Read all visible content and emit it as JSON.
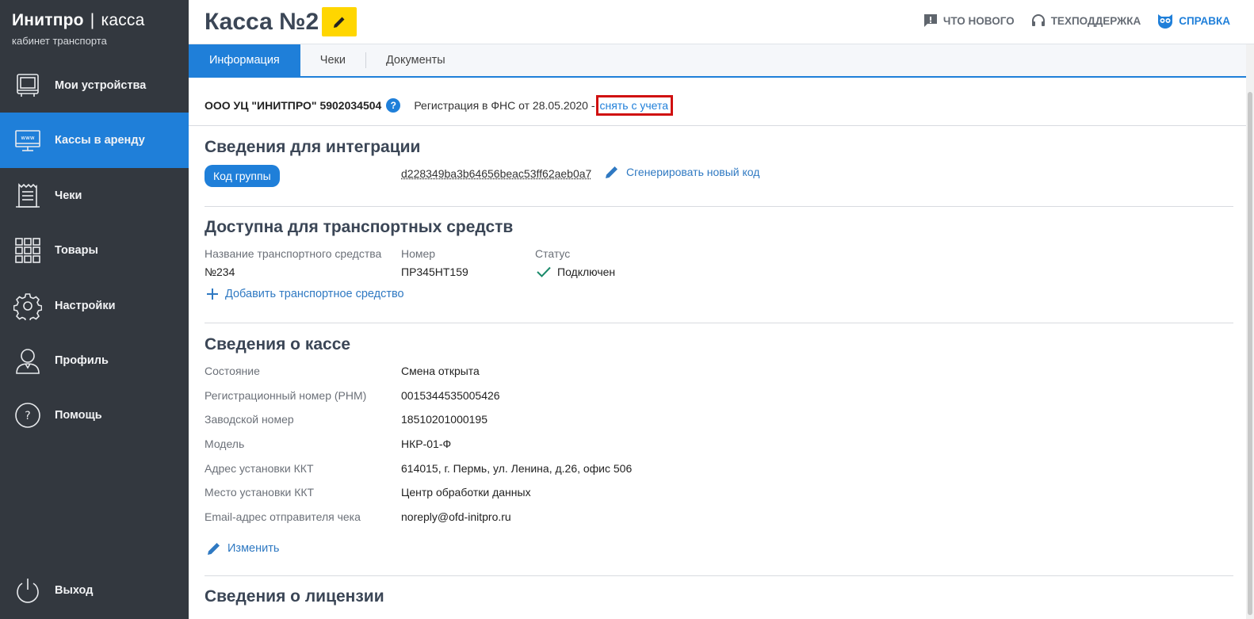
{
  "brand": {
    "title_bold": "Инитпро",
    "separator": "|",
    "title_light": "касса",
    "subtitle": "кабинет транспорта"
  },
  "sidebar": {
    "items": [
      {
        "label": "Мои устройства",
        "icon": "devices-icon"
      },
      {
        "label": "Кассы в аренду",
        "icon": "www-monitor-icon",
        "active": true
      },
      {
        "label": "Чеки",
        "icon": "receipt-icon"
      },
      {
        "label": "Товары",
        "icon": "grid-icon"
      },
      {
        "label": "Настройки",
        "icon": "gear-icon"
      },
      {
        "label": "Профиль",
        "icon": "user-icon"
      },
      {
        "label": "Помощь",
        "icon": "help-circle-icon"
      }
    ],
    "logout": {
      "label": "Выход",
      "icon": "power-icon"
    }
  },
  "header": {
    "title": "Касса №2",
    "links": {
      "whats_new": "ЧТО НОВОГО",
      "support": "ТЕХПОДДЕРЖКА",
      "help": "СПРАВКА"
    }
  },
  "tabs": [
    {
      "label": "Информация",
      "active": true
    },
    {
      "label": "Чеки"
    },
    {
      "label": "Документы"
    }
  ],
  "org": {
    "name": "ООО УЦ \"ИНИТПРО\" 5902034504",
    "help_glyph": "?",
    "registration": "Регистрация в ФНС от 28.05.2020 -",
    "unregister_link": "снять с учета"
  },
  "integration": {
    "title": "Сведения для интеграции",
    "group_code_button": "Код группы",
    "code": "d228349ba3b64656beac53ff62aeb0a7",
    "generate_link": "Сгенерировать новый код"
  },
  "vehicles": {
    "title": "Доступна для транспортных средств",
    "columns": [
      "Название транспортного средства",
      "Номер",
      "Статус"
    ],
    "rows": [
      {
        "name": "№234",
        "number": "ПР345НТ159",
        "status": "Подключен"
      }
    ],
    "add_link": "Добавить транспортное средство"
  },
  "kkt": {
    "title": "Сведения о кассе",
    "fields": [
      {
        "label": "Состояние",
        "value": "Смена открыта"
      },
      {
        "label": "Регистрационный номер (РНМ)",
        "value": "0015344535005426"
      },
      {
        "label": "Заводской номер",
        "value": "18510201000195"
      },
      {
        "label": "Модель",
        "value": "НКР-01-Ф"
      },
      {
        "label": "Адрес установки ККТ",
        "value": "614015, г. Пермь, ул. Ленина, д.26, офис 506"
      },
      {
        "label": "Место установки ККТ",
        "value": "Центр обработки данных"
      },
      {
        "label": "Email-адрес отправителя чека",
        "value": "noreply@ofd-initpro.ru"
      }
    ],
    "edit_link": "Изменить"
  },
  "license": {
    "title": "Сведения о лицензии"
  },
  "colors": {
    "sidebar_bg": "#33383f",
    "accent": "#1f7fd9",
    "edit_yellow": "#ffd600",
    "highlight_red": "#d01010",
    "success": "#1a8a6a"
  }
}
